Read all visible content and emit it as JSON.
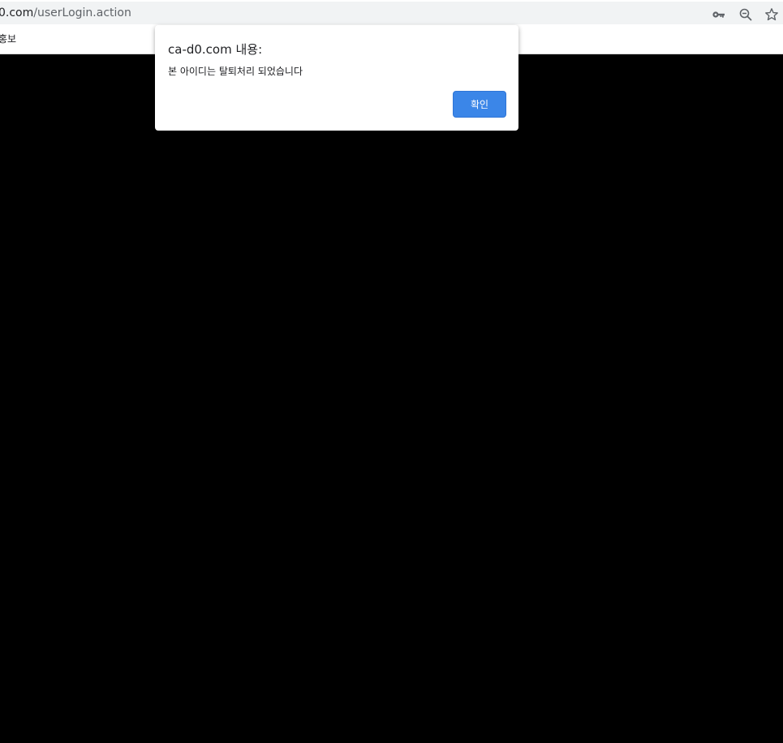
{
  "browser": {
    "url_domain": "0.com",
    "url_path": "/userLogin.action",
    "bookmark_label": "홍보",
    "icons": [
      "key-icon",
      "zoom-out-icon",
      "star-icon"
    ]
  },
  "dialog": {
    "title": "ca-d0.com 내용:",
    "message": "본 아이디는 탈퇴처리 되었습니다",
    "ok_label": "확인"
  },
  "colors": {
    "page_background": "#000000",
    "button_accent": "#3b86e8",
    "address_bar": "#f1f3f4"
  }
}
